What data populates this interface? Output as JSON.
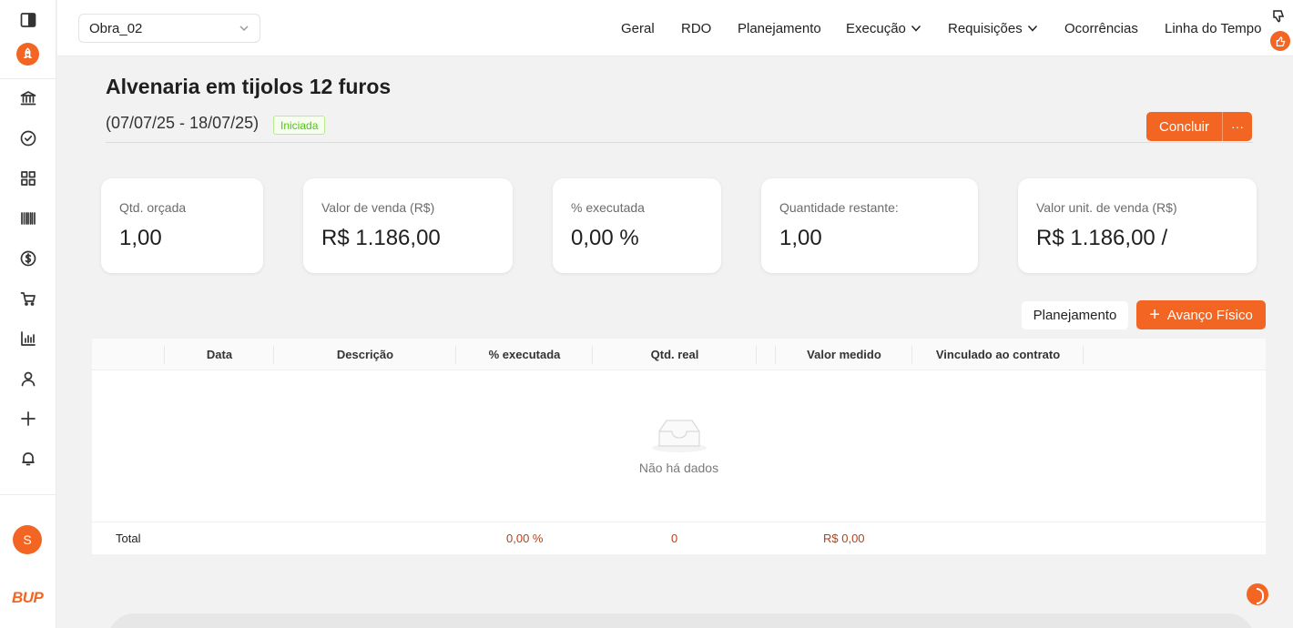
{
  "sidebar": {
    "user_initial": "S",
    "brand": "BUP",
    "icons": [
      "panel-toggle-icon",
      "rocket-icon",
      "bank-icon",
      "check-circle-icon",
      "grid-icon",
      "barcode-icon",
      "dollar-icon",
      "cart-icon",
      "bar-chart-icon",
      "user-icon",
      "plus-icon",
      "bell-icon"
    ]
  },
  "topbar": {
    "project": "Obra_02",
    "nav": {
      "geral": "Geral",
      "rdo": "RDO",
      "planejamento": "Planejamento",
      "execucao": "Execução",
      "requisicoes": "Requisições",
      "ocorrencias": "Ocorrências",
      "linha_tempo": "Linha do Tempo"
    }
  },
  "header": {
    "title": "Alvenaria em tijolos 12 furos",
    "date_range": "(07/07/25 - 18/07/25)",
    "status": "Iniciada",
    "conclude_label": "Concluir",
    "more_label": "···"
  },
  "stats": {
    "qtd_orcada": {
      "label": "Qtd. orçada",
      "value": "1,00"
    },
    "valor_venda": {
      "label": "Valor de venda (R$)",
      "value": "R$ 1.186,00"
    },
    "executada": {
      "label": "% executada",
      "value": "0,00 %"
    },
    "restante": {
      "label": "Quantidade restante:",
      "value": "1,00"
    },
    "valor_unit": {
      "label": "Valor unit. de venda (R$)",
      "value": "R$ 1.186,00 /"
    }
  },
  "actions": {
    "planejamento": "Planejamento",
    "avanco": "Avanço Físico"
  },
  "table": {
    "columns": {
      "data": "Data",
      "descricao": "Descrição",
      "executada": "% executada",
      "qtd_real": "Qtd. real",
      "valor_medido": "Valor medido",
      "vinculado": "Vinculado ao contrato"
    },
    "empty": "Não há dados",
    "footer": {
      "label": "Total",
      "executada": "0,00 %",
      "qtd_real": "0",
      "valor_medido": "R$ 0,00"
    }
  },
  "colors": {
    "accent": "#f26522",
    "status_green": "#52c41a",
    "total_value": "#b7401a"
  }
}
